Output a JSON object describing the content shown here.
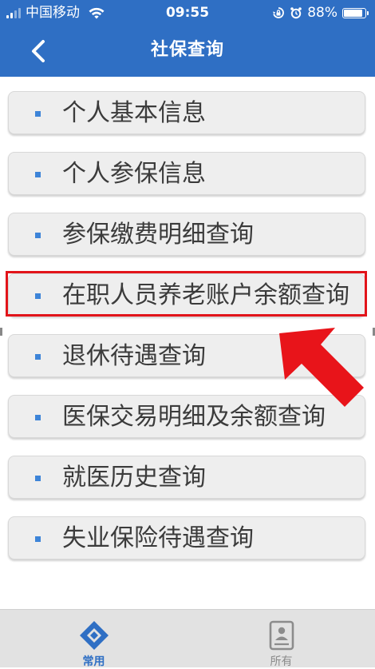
{
  "status_bar": {
    "carrier": "中国移动",
    "time": "09:55",
    "battery": "88%",
    "battery_level": 0.88
  },
  "nav": {
    "title": "社保查询",
    "back_icon": "chevron-left-icon"
  },
  "menu": {
    "items": [
      {
        "label": "个人基本信息"
      },
      {
        "label": "个人参保信息"
      },
      {
        "label": "参保缴费明细查询"
      },
      {
        "label": "在职人员养老账户余额查询",
        "highlighted": true
      },
      {
        "label": "退休待遇查询"
      },
      {
        "label": "医保交易明细及余额查询"
      },
      {
        "label": "就医历史查询"
      },
      {
        "label": "失业保险待遇查询"
      }
    ]
  },
  "tabbar": {
    "tabs": [
      {
        "label": "常用",
        "icon": "diamond-icon",
        "active": true
      },
      {
        "label": "所有",
        "icon": "document-icon",
        "active": false
      }
    ]
  },
  "colors": {
    "header": "#2f6fc4",
    "accent_bullet": "#3d84d8",
    "highlight_border": "#e2141a",
    "arrow": "#e8141a"
  }
}
